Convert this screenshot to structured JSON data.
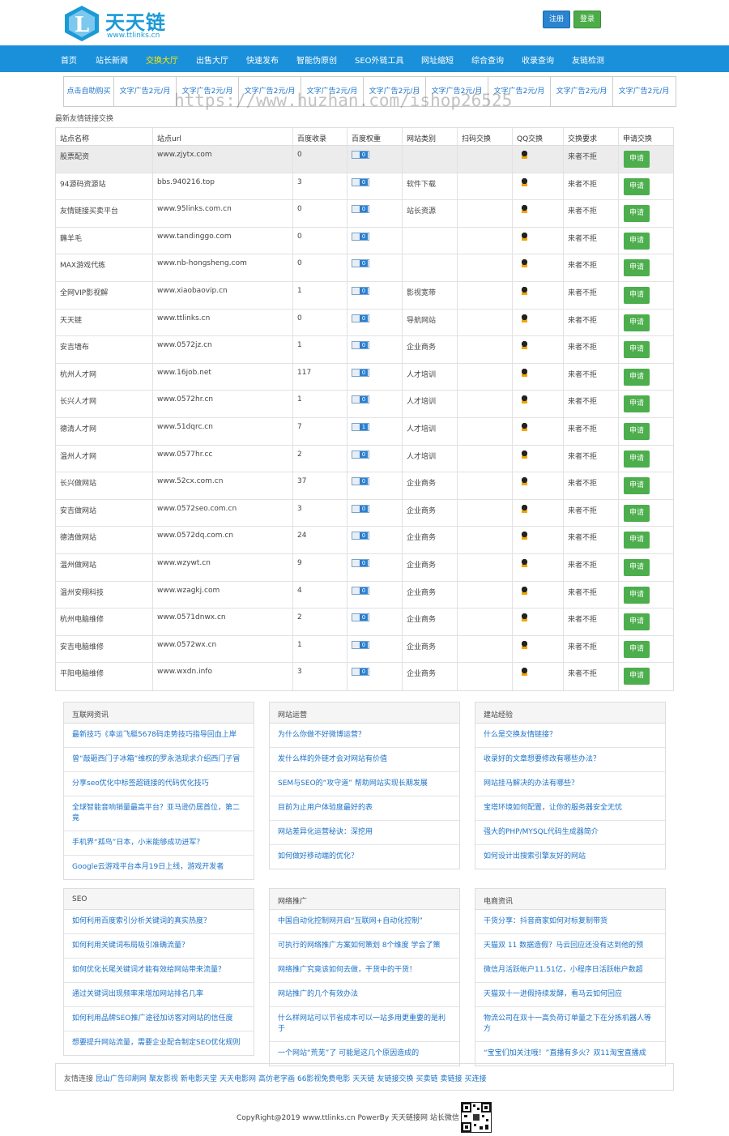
{
  "brand": {
    "name": "天天链",
    "url": "www.ttlinks.cn",
    "letter": "L"
  },
  "header": {
    "register": "注册",
    "login": "登录"
  },
  "nav": [
    {
      "label": "首页",
      "active": false
    },
    {
      "label": "站长新闻",
      "active": false
    },
    {
      "label": "交换大厅",
      "active": true
    },
    {
      "label": "出售大厅",
      "active": false
    },
    {
      "label": "快速发布",
      "active": false
    },
    {
      "label": "智能伪原创",
      "active": false
    },
    {
      "label": "SEO外链工具",
      "active": false
    },
    {
      "label": "网址缩短",
      "active": false
    },
    {
      "label": "综合查询",
      "active": false
    },
    {
      "label": "收录查询",
      "active": false
    },
    {
      "label": "友链检测",
      "active": false
    }
  ],
  "ads": [
    "点击自助购买",
    "文字广告2元/月",
    "文字广告2元/月",
    "文字广告2元/月",
    "文字广告2元/月",
    "文字广告2元/月",
    "文字广告2元/月",
    "文字广告2元/月",
    "文字广告2元/月",
    "文字广告2元/月"
  ],
  "watermark": "https://www.huzhan.com/ishop26525",
  "section_title": "最新友情链接交换",
  "table": {
    "headers": [
      "站点名称",
      "站点url",
      "百度收录",
      "百度权重",
      "网站类别",
      "扫码交换",
      "QQ交换",
      "交换要求",
      "申请交换"
    ],
    "apply_label": "申请",
    "rows": [
      {
        "name": "股票配资",
        "url": "www.zjytx.com",
        "index": "0",
        "weight": "0",
        "category": "",
        "req": "来者不拒"
      },
      {
        "name": "94源码资源站",
        "url": "bbs.940216.top",
        "index": "3",
        "weight": "0",
        "category": "软件下载",
        "req": "来者不拒"
      },
      {
        "name": "友情链接买卖平台",
        "url": "www.95links.com.cn",
        "index": "0",
        "weight": "0",
        "category": "站长资源",
        "req": "来者不拒"
      },
      {
        "name": "薅羊毛",
        "url": "www.tandinggo.com",
        "index": "0",
        "weight": "0",
        "category": "",
        "req": "来者不拒"
      },
      {
        "name": "MAX游戏代练",
        "url": "www.nb-hongsheng.com",
        "index": "0",
        "weight": "0",
        "category": "",
        "req": "来者不拒"
      },
      {
        "name": "全网VIP影视解",
        "url": "www.xiaobaovip.cn",
        "index": "1",
        "weight": "0",
        "category": "影视宽带",
        "req": "来者不拒"
      },
      {
        "name": "天天链",
        "url": "www.ttlinks.cn",
        "index": "0",
        "weight": "0",
        "category": "导航网站",
        "req": "来者不拒"
      },
      {
        "name": "安吉墙布",
        "url": "www.0572jz.cn",
        "index": "1",
        "weight": "0",
        "category": "企业商务",
        "req": "来者不拒"
      },
      {
        "name": "杭州人才网",
        "url": "www.16job.net",
        "index": "117",
        "weight": "0",
        "category": "人才培训",
        "req": "来者不拒"
      },
      {
        "name": "长兴人才网",
        "url": "www.0572hr.cn",
        "index": "1",
        "weight": "0",
        "category": "人才培训",
        "req": "来者不拒"
      },
      {
        "name": "德清人才网",
        "url": "www.51dqrc.cn",
        "index": "7",
        "weight": "1",
        "category": "人才培训",
        "req": "来者不拒"
      },
      {
        "name": "温州人才网",
        "url": "www.0577hr.cc",
        "index": "2",
        "weight": "0",
        "category": "人才培训",
        "req": "来者不拒"
      },
      {
        "name": "长兴做网站",
        "url": "www.52cx.com.cn",
        "index": "37",
        "weight": "0",
        "category": "企业商务",
        "req": "来者不拒"
      },
      {
        "name": "安吉做网站",
        "url": "www.0572seo.com.cn",
        "index": "3",
        "weight": "0",
        "category": "企业商务",
        "req": "来者不拒"
      },
      {
        "name": "德清做网站",
        "url": "www.0572dq.com.cn",
        "index": "24",
        "weight": "0",
        "category": "企业商务",
        "req": "来者不拒"
      },
      {
        "name": "温州做网站",
        "url": "www.wzywt.cn",
        "index": "9",
        "weight": "0",
        "category": "企业商务",
        "req": "来者不拒"
      },
      {
        "name": "温州安翔科技",
        "url": "www.wzagkj.com",
        "index": "4",
        "weight": "0",
        "category": "企业商务",
        "req": "来者不拒"
      },
      {
        "name": "杭州电脑维修",
        "url": "www.0571dnwx.cn",
        "index": "2",
        "weight": "0",
        "category": "企业商务",
        "req": "来者不拒"
      },
      {
        "name": "安吉电脑维修",
        "url": "www.0572wx.cn",
        "index": "1",
        "weight": "0",
        "category": "企业商务",
        "req": "来者不拒"
      },
      {
        "name": "平阳电脑维修",
        "url": "www.wxdn.info",
        "index": "3",
        "weight": "0",
        "category": "企业商务",
        "req": "来者不拒"
      }
    ]
  },
  "boxes": [
    {
      "title": "互联网资讯",
      "items": [
        "最新技巧《幸运飞艇5678码走势技巧指导回血上岸",
        "曾“敲砸西门子冰箱”维权的罗永浩现求介绍西门子冒",
        "分享seo优化中标签超链接的代码优化技巧",
        "全球智能音响销量最高平台？亚马逊仍居首位，第二竟",
        "手机界“孤鸟”日本，小米能够成功进军？",
        "Google云游戏平台本月19日上线，游戏开发者"
      ]
    },
    {
      "title": "网站运营",
      "items": [
        "为什么你做不好微博运营？",
        "发什么样的外链才会对网站有价值",
        "SEM与SEO的“攻守道” 帮助网站实现长期发展",
        "目前为止用户体验度最好的表",
        "网站差异化运营秘诀：深挖用",
        "如何做好移动端的优化？"
      ]
    },
    {
      "title": "建站经验",
      "items": [
        "什么是交换友情链接？",
        "收录好的文章想要修改有哪些办法？",
        "网站挂马解决的办法有哪些？",
        "宝塔环境如何配置，让你的服务器安全无忧",
        "强大的PHP/MYSQL代码生成器简介",
        "如何设计出搜索引擎友好的网站"
      ]
    },
    {
      "title": "SEO",
      "items": [
        "如何利用百度索引分析关键词的真实热度？",
        "如何利用关键词布局吸引准确流量？",
        "如何优化长尾关键词才能有效给网站带来流量？",
        "通过关键词出现频率来增加网站排名几率",
        "如何利用品牌SEO推广途径加访客对网站的信任度",
        "想要提升网站流量，需要企业配合制定SEO优化规则"
      ]
    },
    {
      "title": "网络推广",
      "items": [
        "中国自动化控制网开启“互联网+自动化控制”",
        "可执行的网络推广方案如何策划 8个维度 学会了策",
        "网络推广究竟该如何去做，干货中的干货！",
        "网站推广的几个有效办法",
        "什么样网站可以节省成本可以一站多用更重要的是利于",
        "一个网站“荒芜”了 可能是这几个原因造成的"
      ]
    },
    {
      "title": "电商资讯",
      "items": [
        "干货分享：抖音商家如何对标复制带货",
        "天猫双 11 数据造假？马云回应还没有达到他的预",
        "微信月活跃帐户11.51亿，小程序日活跃帐户数超",
        "天猫双十一进假持续发酵，看马云如何回应",
        "物流公司在双十一高负荷订单量之下在分拣机器人等方",
        "“宝宝们加关注哦！”直播有多火？双11淘宝直播成"
      ]
    }
  ],
  "friends": {
    "label": "友情连接",
    "links": [
      "昆山广告印刷网",
      "聚友影视",
      "新电影天堂",
      "天天电影网",
      "高仿老字画",
      "66影视免费电影",
      "天天链",
      "友链接交换",
      "买卖链",
      "卖链接",
      "买连接"
    ]
  },
  "footer": {
    "copyright": "CopyRight@2019 www.ttlinks.cn PowerBy 天天链接网 站长微信"
  }
}
